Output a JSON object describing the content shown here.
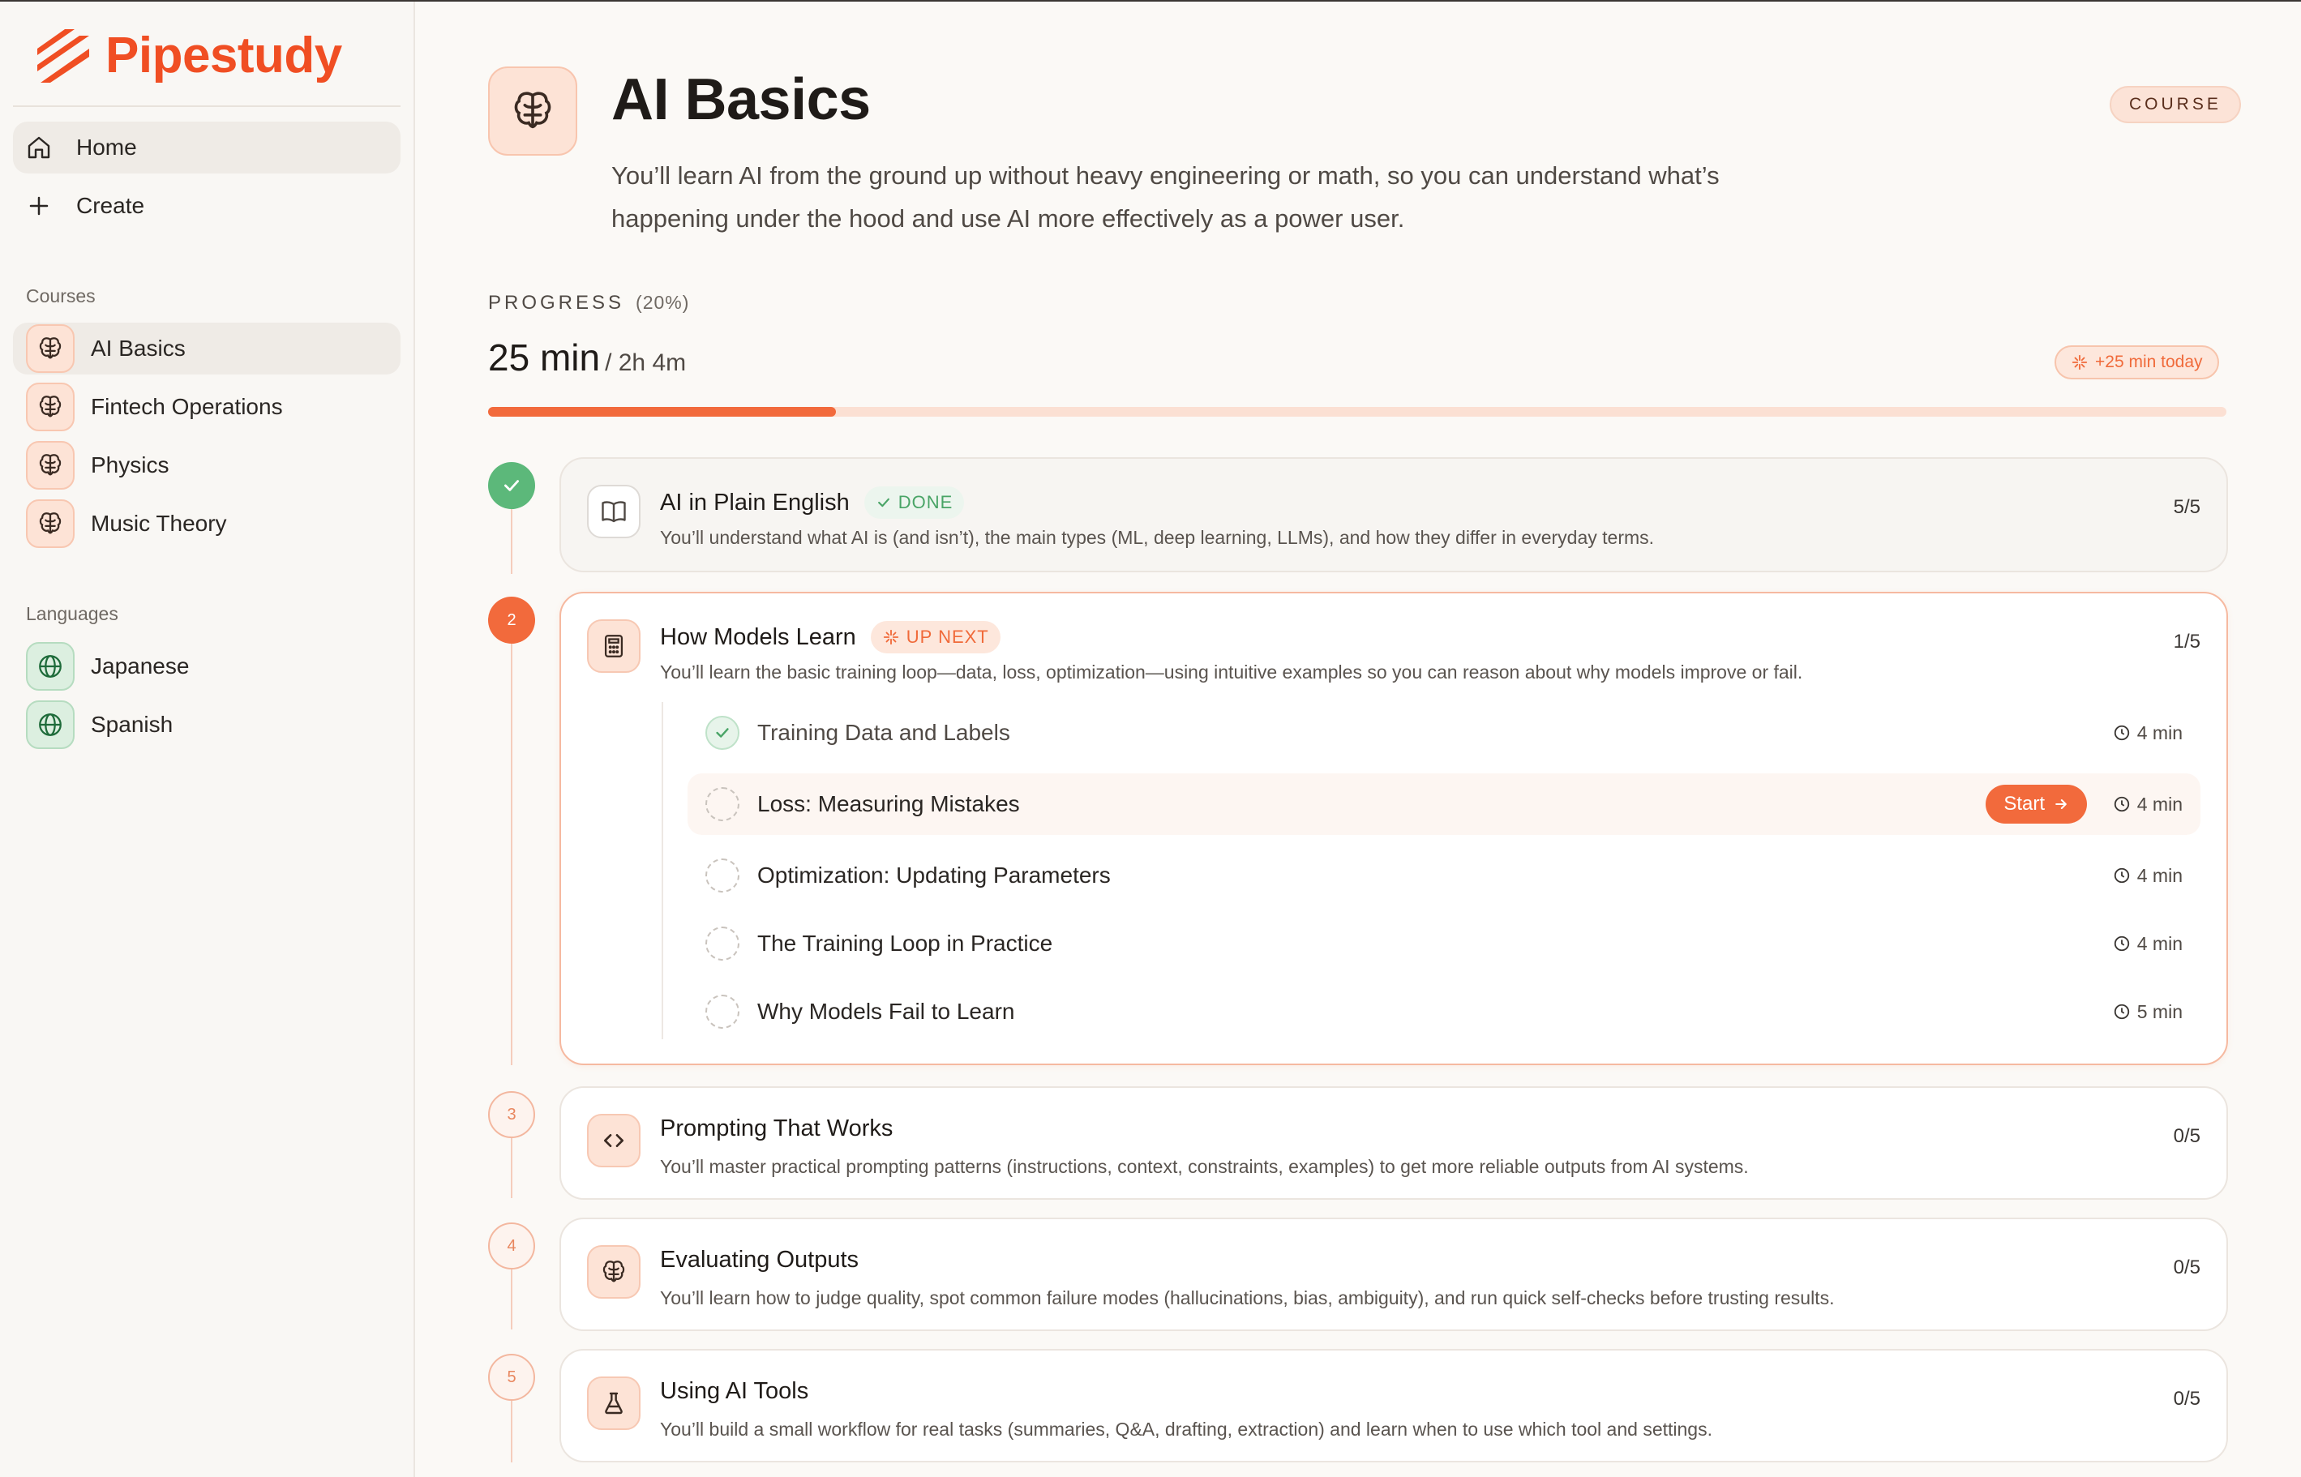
{
  "brand": {
    "name": "Pipestudy",
    "accent": "#f04e23"
  },
  "nav": [
    {
      "label": "Home",
      "icon": "home-icon"
    },
    {
      "label": "Create",
      "icon": "plus-icon"
    }
  ],
  "sidebar": {
    "courses_label": "Courses",
    "courses": [
      {
        "label": "AI Basics",
        "icon": "brain-icon"
      },
      {
        "label": "Fintech Operations",
        "icon": "brain-icon"
      },
      {
        "label": "Physics",
        "icon": "brain-icon"
      },
      {
        "label": "Music Theory",
        "icon": "brain-icon"
      }
    ],
    "languages_label": "Languages",
    "languages": [
      {
        "label": "Japanese",
        "icon": "globe-icon"
      },
      {
        "label": "Spanish",
        "icon": "globe-icon"
      }
    ]
  },
  "course": {
    "title": "AI Basics",
    "badge": "COURSE",
    "description": "You’ll learn AI from the ground up without heavy engineering or math, so you can understand what’s happening under the hood and use AI more effectively as a power user."
  },
  "progress": {
    "label": "PROGRESS",
    "percent_text": "(20%)",
    "percent": 20,
    "elapsed": "25 min",
    "total": "/ 2h 4m",
    "today": "+25 min today"
  },
  "modules": [
    {
      "number": "1",
      "title": "AI in Plain English",
      "status": "DONE",
      "count": "5/5",
      "description": "You’ll understand what AI is (and isn’t), the main types (ML, deep learning, LLMs), and how they differ in everyday terms.",
      "icon": "book-icon"
    },
    {
      "number": "2",
      "title": "How Models Learn",
      "status": "UP NEXT",
      "count": "1/5",
      "description": "You’ll learn the basic training loop—data, loss, optimization—using intuitive examples so you can reason about why models improve or fail.",
      "icon": "calculator-icon",
      "lessons": [
        {
          "title": "Training Data and Labels",
          "duration": "4 min",
          "state": "done"
        },
        {
          "title": "Loss: Measuring Mistakes",
          "duration": "4 min",
          "state": "current",
          "action": "Start"
        },
        {
          "title": "Optimization: Updating Parameters",
          "duration": "4 min",
          "state": "todo"
        },
        {
          "title": "The Training Loop in Practice",
          "duration": "4 min",
          "state": "todo"
        },
        {
          "title": "Why Models Fail to Learn",
          "duration": "5 min",
          "state": "todo"
        }
      ]
    },
    {
      "number": "3",
      "title": "Prompting That Works",
      "count": "0/5",
      "description": "You’ll master practical prompting patterns (instructions, context, constraints, examples) to get more reliable outputs from AI systems.",
      "icon": "code-icon"
    },
    {
      "number": "4",
      "title": "Evaluating Outputs",
      "count": "0/5",
      "description": "You’ll learn how to judge quality, spot common failure modes (hallucinations, bias, ambiguity), and run quick self-checks before trusting results.",
      "icon": "brain-icon"
    },
    {
      "number": "5",
      "title": "Using AI Tools",
      "count": "0/5",
      "description": "You’ll build a small workflow for real tasks (summaries, Q&A, drafting, extraction) and learn when to use which tool and settings.",
      "icon": "flask-icon"
    }
  ]
}
